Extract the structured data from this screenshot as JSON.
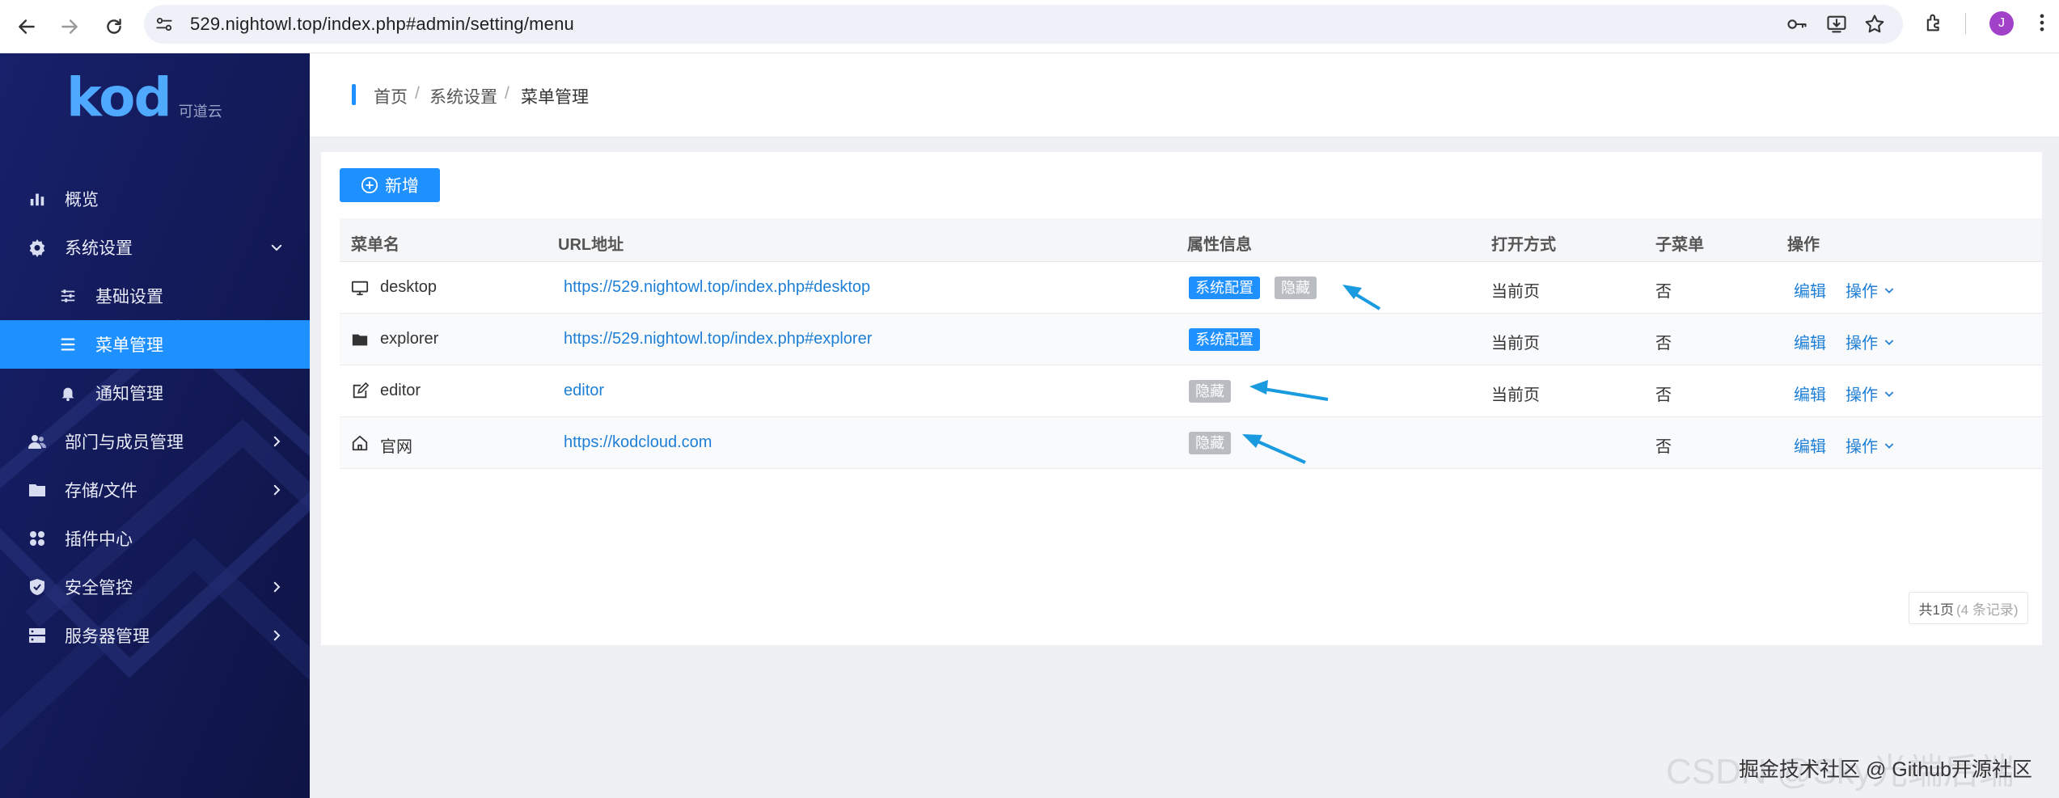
{
  "browser": {
    "url": "529.nightowl.top/index.php#admin/setting/menu",
    "profile_initial": "J"
  },
  "sidebar": {
    "logo_text": "kod",
    "logo_sub": "可道云",
    "items": [
      {
        "label": "概览",
        "icon": "chart-icon"
      },
      {
        "label": "系统设置",
        "icon": "gear-icon",
        "expanded": true
      },
      {
        "label": "基础设置",
        "icon": "sliders-icon",
        "sub": true
      },
      {
        "label": "菜单管理",
        "icon": "menu-icon",
        "sub": true,
        "active": true
      },
      {
        "label": "通知管理",
        "icon": "bell-icon",
        "sub": true
      },
      {
        "label": "部门与成员管理",
        "icon": "users-icon"
      },
      {
        "label": "存储/文件",
        "icon": "folder-icon"
      },
      {
        "label": "插件中心",
        "icon": "apps-icon"
      },
      {
        "label": "安全管控",
        "icon": "shield-icon"
      },
      {
        "label": "服务器管理",
        "icon": "server-icon"
      }
    ],
    "active_color": "#1e90ff",
    "bg_color": "#141a55"
  },
  "breadcrumb": {
    "items": [
      "首页",
      "系统设置",
      "菜单管理"
    ],
    "separator": "/"
  },
  "toolbar": {
    "add_label": "新增"
  },
  "table": {
    "columns": [
      "菜单名",
      "URL地址",
      "属性信息",
      "打开方式",
      "子菜单",
      "操作"
    ],
    "rows": [
      {
        "name": "desktop",
        "icon": "monitor-icon",
        "url": "https://529.nightowl.top/index.php#desktop",
        "tags": [
          {
            "text": "系统配置",
            "type": "blue"
          },
          {
            "text": "隐藏",
            "type": "gray"
          }
        ],
        "open": "当前页",
        "child": "否",
        "edit": "编辑",
        "op": "操作"
      },
      {
        "name": "explorer",
        "icon": "folder-icon",
        "url": "https://529.nightowl.top/index.php#explorer",
        "tags": [
          {
            "text": "系统配置",
            "type": "blue"
          }
        ],
        "open": "当前页",
        "child": "否",
        "edit": "编辑",
        "op": "操作"
      },
      {
        "name": "editor",
        "icon": "edit-icon",
        "url": "editor",
        "tags": [
          {
            "text": "隐藏",
            "type": "gray"
          }
        ],
        "open": "当前页",
        "child": "否",
        "edit": "编辑",
        "op": "操作"
      },
      {
        "name": "官网",
        "icon": "home-icon",
        "url": "https://kodcloud.com",
        "tags": [
          {
            "text": "隐藏",
            "type": "gray"
          }
        ],
        "open": "",
        "child": "否",
        "edit": "编辑",
        "op": "操作"
      }
    ]
  },
  "pager": {
    "pages": "共1页",
    "records": "(4 条记录)"
  },
  "watermark": {
    "text": "掘金技术社区 @ Github开源社区",
    "faded": "CSDN @Sky光端后端"
  },
  "colors": {
    "accent": "#1e90ff",
    "tag_gray": "#b9bcc1",
    "arrow": "#1a9be0"
  }
}
